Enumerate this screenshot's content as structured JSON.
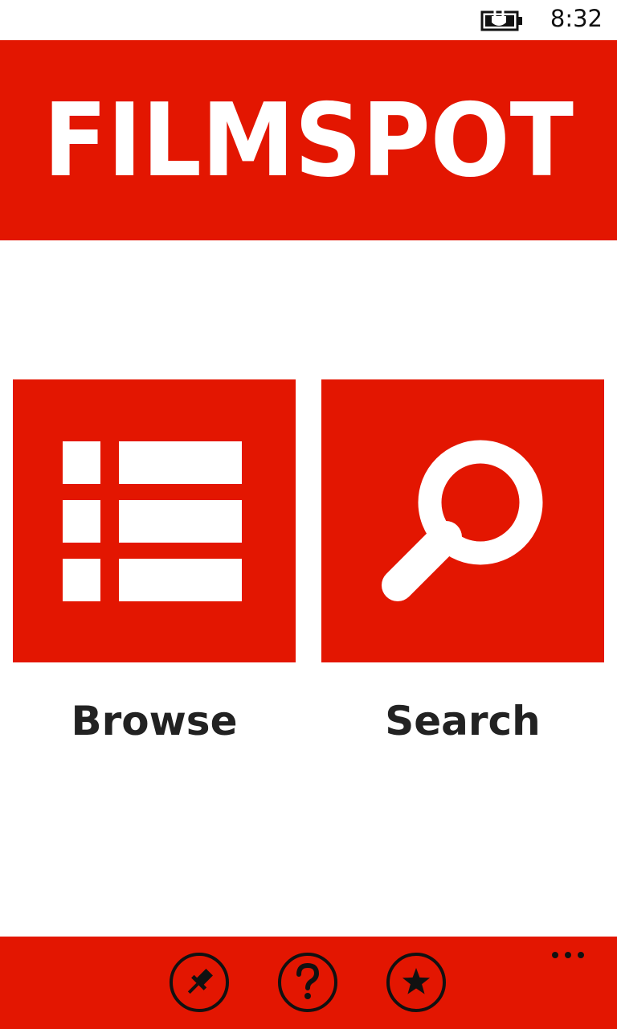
{
  "status_bar": {
    "time": "8:32",
    "battery_icon": "battery-charging-icon"
  },
  "header": {
    "logo_text": "FILMSPOT",
    "background_color": "#e31601"
  },
  "tiles": [
    {
      "label": "Browse",
      "icon": "list-icon"
    },
    {
      "label": "Search",
      "icon": "magnifier-icon"
    }
  ],
  "app_bar": {
    "buttons": [
      {
        "icon": "pin-icon"
      },
      {
        "icon": "help-icon"
      },
      {
        "icon": "star-icon"
      }
    ],
    "more_icon": "ellipsis-icon"
  },
  "colors": {
    "accent": "#e31601",
    "label_text": "#222222",
    "background": "#ffffff"
  }
}
